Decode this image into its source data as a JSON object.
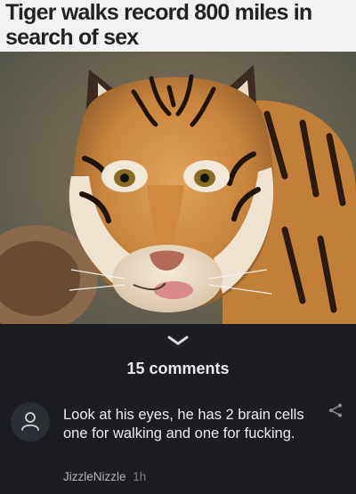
{
  "article": {
    "headline_line1": "Tiger walks record 800 miles in",
    "headline_line2": "search of sex"
  },
  "comments": {
    "count_label": "15 comments",
    "items": [
      {
        "text": "Look at his eyes, he has 2 brain cells one for walking and one for fucking.",
        "author": "JizzleNizzle",
        "time": "1h"
      }
    ]
  },
  "icons": {
    "collapse": "chevron-down-icon",
    "avatar": "user-icon",
    "share": "share-icon"
  },
  "colors": {
    "background": "#1c1d22",
    "headline_bg": "#f2f2f2",
    "text": "#ececec",
    "muted": "#7d7e85"
  }
}
